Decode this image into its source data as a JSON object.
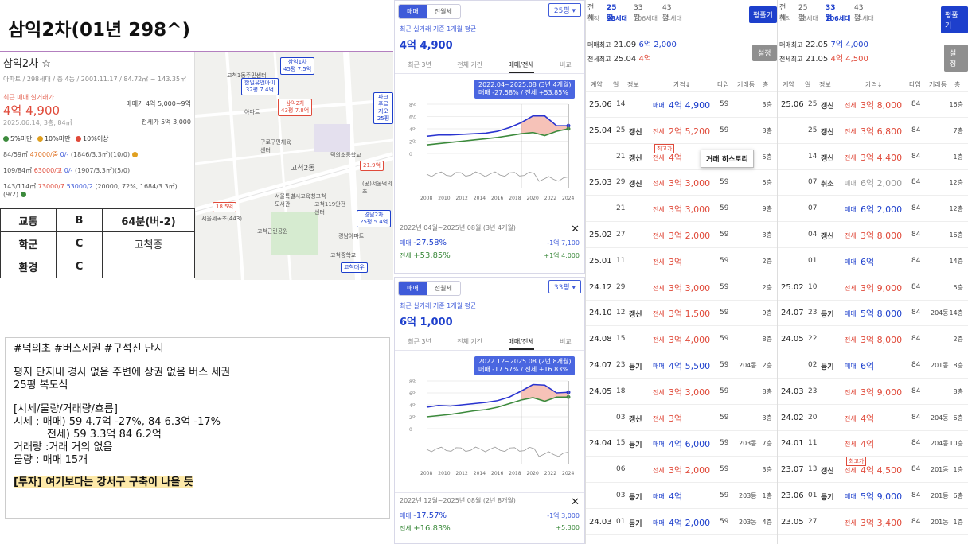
{
  "title": "삼익2차(01년 298^)",
  "card": {
    "name": "삼익2차 ☆",
    "info": "아파트 / 298세대 / 총 4동 / 2001.11.17 / 84.72㎡ ~ 143.35㎡",
    "recent_label": "최근 매매 실거래가",
    "recent_price": "4억 4,900",
    "recent_date": "2025.06.14, 3층, 84㎡",
    "sale_range": "매매가 4억 5,000~9억",
    "rent_range": "전세가 5억 3,000",
    "legend": [
      "5%미만",
      "10%미만",
      "10%이상"
    ],
    "legend_colors": [
      "#3c8a3c",
      "#e0a020",
      "#e04a3a"
    ],
    "rows": [
      {
        "a": "84/59㎡",
        "b": "47000/중",
        "c": "0/-",
        "d": "(1846/3.3㎡)(10/0)"
      },
      {
        "a": "109/84㎡",
        "b": "63000/고",
        "c": "0/-",
        "d": "(1907/3.3㎡)(5/0)"
      },
      {
        "a": "143/114㎡",
        "b": "73000/7",
        "c": "53000/2",
        "d": "(20000, 72%, 1684/3.3㎡)(9/2)"
      }
    ]
  },
  "grades": [
    {
      "k": "교통",
      "g": "B",
      "v": "64분(버-2)"
    },
    {
      "k": "학군",
      "g": "C",
      "v": "고척중"
    },
    {
      "k": "환경",
      "g": "C",
      "v": ""
    }
  ],
  "map": {
    "pins": [
      {
        "t1": "삼익1차",
        "t2": "45평 7.5억",
        "red": false
      },
      {
        "t1": "한일유앤아이",
        "t2": "32평 7.4억",
        "red": false
      },
      {
        "t1": "삼익2차",
        "t2": "43평 7.8억",
        "red": true
      },
      {
        "t1": "파크푸르지오",
        "t2": "25평",
        "red": false
      },
      {
        "t1": "경남2차",
        "t2": "25평 5.4억",
        "red": false
      },
      {
        "t1": "고척대우",
        "t2": "",
        "red": false
      },
      {
        "t1": "21.9억",
        "t2": "",
        "red": true
      },
      {
        "t1": "18.5억",
        "t2": "",
        "red": true
      }
    ],
    "labels": [
      "고척1동주민센터",
      "아파트",
      "구로구민체육센터",
      "고척2동",
      "덕의초등학교",
      "서울특별시교육청고척도서관",
      "고척근린공원",
      "고척119안전센터",
      "서울세곡초(443)",
      "(공)서울덕의초",
      "경남아파트",
      "고척중학교"
    ]
  },
  "memo": {
    "tags": "#덕의초 #버스세권 #구석진 단지",
    "line1": "평지 단지내 경사 없음 주변에 상권 없음 버스 세권",
    "line2": "25평 복도식",
    "line3": "[시세/물량/거래량/흐름]",
    "line4": "시세 : 매매) 59 4.7억 -27%, 84 6.3억 -17%",
    "line5": "전세) 59 3.3억 84 6.2억",
    "line6": "거래량 :거래 거의 없음",
    "line7": "물량 : 매매 15개",
    "line8": "[투자] 여기보다는 강서구 구축이 나을 듯"
  },
  "charts": [
    {
      "seg": [
        "매매",
        "전월세"
      ],
      "size": "25평 ▾",
      "avg_label": "최근 실거래 기준 1개월 평균",
      "avg_price": "4억 4,900",
      "tabs": [
        "최근 3년",
        "전체 기간",
        "매매/전세",
        "비교"
      ],
      "tip1": "2022.04~2025.08 (3년 4개월)",
      "tip2": "매매 -27.58%  /  전세 +53.85%",
      "period": "2022년 04월~2025년 08월 (3년 4개월)",
      "sale_l": "매매",
      "sale_pct": "-27.58%",
      "sale_amt": "-1억 7,100",
      "rent_l": "전세",
      "rent_pct": "+53.85%",
      "rent_amt": "+1억 4,000",
      "close": "✕"
    },
    {
      "seg": [
        "매매",
        "전월세"
      ],
      "size": "33평 ▾",
      "avg_label": "최근 실거래 기준 1개월 평균",
      "avg_price": "6억 1,000",
      "tabs": [
        "최근 3년",
        "전체 기간",
        "매매/전세",
        "비교"
      ],
      "tip1": "2022.12~2025.08 (2년 8개월)",
      "tip2": "매매 -17.57%  /  전세 +16.83%",
      "period": "2022년 12월~2025년 08월 (2년 8개월)",
      "sale_l": "매매",
      "sale_pct": "-17.57%",
      "sale_amt": "-1억 3,000",
      "rent_l": "전세",
      "rent_pct": "+16.83%",
      "rent_amt": "+5,300",
      "close": "✕"
    }
  ],
  "chart_data": [
    {
      "type": "line",
      "xlabels": [
        "2008",
        "2010",
        "2012",
        "2014",
        "2016",
        "2018",
        "2020",
        "2022",
        "2024"
      ],
      "ylabels": [
        "8억",
        "6억",
        "4억",
        "2억",
        "0"
      ],
      "series": [
        {
          "name": "매매",
          "values": [
            2.8,
            3.0,
            3.0,
            3.1,
            3.2,
            3.3,
            3.6,
            4.2,
            5.0,
            6.1,
            6.1,
            4.5,
            4.5
          ]
        },
        {
          "name": "전세",
          "values": [
            1.4,
            1.6,
            1.8,
            2.0,
            2.2,
            2.4,
            2.6,
            2.9,
            3.2,
            3.4,
            2.9,
            3.6,
            4.0
          ]
        }
      ]
    },
    {
      "type": "line",
      "xlabels": [
        "2008",
        "2010",
        "2012",
        "2014",
        "2016",
        "2018",
        "2020",
        "2022",
        "2024"
      ],
      "ylabels": [
        "8억",
        "6억",
        "4억",
        "2억",
        "0"
      ],
      "series": [
        {
          "name": "매매",
          "values": [
            3.6,
            3.9,
            3.8,
            4.0,
            4.2,
            4.4,
            4.7,
            5.3,
            6.3,
            7.4,
            7.3,
            6.0,
            6.1
          ]
        },
        {
          "name": "전세",
          "values": [
            2.0,
            2.2,
            2.4,
            2.7,
            3.0,
            3.2,
            3.6,
            4.2,
            4.8,
            5.2,
            4.6,
            5.3,
            5.3
          ]
        }
      ]
    }
  ],
  "table1": {
    "hdr1": [
      "전체",
      "25평",
      "33평",
      "43평"
    ],
    "hdr2": [
      "면적",
      "98세대",
      "106세대",
      "94세대"
    ],
    "pbtn": "평풀기",
    "sbtn": "설정",
    "hi1_l": "매매최고",
    "hi1_d": "21.09",
    "hi1_p": "6억 2,000",
    "hi2_l": "전세최고",
    "hi2_d": "25.04",
    "hi2_p": "4억",
    "cols": [
      "계약",
      "일",
      "정보",
      "가격↓",
      "타입",
      "거래동",
      "층"
    ],
    "hist": "거래 히스토리",
    "rows": [
      {
        "ym": "25.06",
        "d": "14",
        "i": "",
        "k": "매매",
        "p": "4억 4,900",
        "t": "59",
        "dong": "",
        "f": "3층"
      },
      {
        "ym": "25.04",
        "d": "25",
        "i": "갱신",
        "k": "전세",
        "p": "2억 5,200",
        "t": "59",
        "dong": "",
        "f": "3층"
      },
      {
        "ym": "",
        "d": "21",
        "i": "갱신",
        "k": "전세",
        "p": "4억",
        "t": "59",
        "dong": "",
        "f": "5층",
        "max": "최고가"
      },
      {
        "ym": "25.03",
        "d": "29",
        "i": "갱신",
        "k": "전세",
        "p": "3억 3,000",
        "t": "59",
        "dong": "",
        "f": "5층"
      },
      {
        "ym": "",
        "d": "21",
        "i": "",
        "k": "전세",
        "p": "3억 3,000",
        "t": "59",
        "dong": "",
        "f": "9층"
      },
      {
        "ym": "25.02",
        "d": "27",
        "i": "",
        "k": "전세",
        "p": "3억 2,000",
        "t": "59",
        "dong": "",
        "f": "3층"
      },
      {
        "ym": "25.01",
        "d": "11",
        "i": "",
        "k": "전세",
        "p": "3억",
        "t": "59",
        "dong": "",
        "f": "2층"
      },
      {
        "ym": "24.12",
        "d": "29",
        "i": "",
        "k": "전세",
        "p": "3억 3,000",
        "t": "59",
        "dong": "",
        "f": "2층"
      },
      {
        "ym": "24.10",
        "d": "12",
        "i": "갱신",
        "k": "전세",
        "p": "3억 1,500",
        "t": "59",
        "dong": "",
        "f": "9층"
      },
      {
        "ym": "24.08",
        "d": "15",
        "i": "",
        "k": "전세",
        "p": "3억 4,000",
        "t": "59",
        "dong": "",
        "f": "8층"
      },
      {
        "ym": "24.07",
        "d": "23",
        "i": "등기",
        "k": "매매",
        "p": "4억 5,500",
        "t": "59",
        "dong": "204동",
        "f": "2층"
      },
      {
        "ym": "24.05",
        "d": "18",
        "i": "",
        "k": "전세",
        "p": "3억 3,000",
        "t": "59",
        "dong": "",
        "f": "8층"
      },
      {
        "ym": "",
        "d": "03",
        "i": "갱신",
        "k": "전세",
        "p": "3억",
        "t": "59",
        "dong": "",
        "f": "3층"
      },
      {
        "ym": "24.04",
        "d": "15",
        "i": "등기",
        "k": "매매",
        "p": "4억 6,000",
        "t": "59",
        "dong": "203동",
        "f": "7층"
      },
      {
        "ym": "",
        "d": "06",
        "i": "",
        "k": "전세",
        "p": "3억 2,000",
        "t": "59",
        "dong": "",
        "f": "3층"
      },
      {
        "ym": "",
        "d": "03",
        "i": "등기",
        "k": "매매",
        "p": "4억",
        "t": "59",
        "dong": "203동",
        "f": "1층"
      },
      {
        "ym": "24.03",
        "d": "01",
        "i": "등기",
        "k": "매매",
        "p": "4억 2,000",
        "t": "59",
        "dong": "203동",
        "f": "4층"
      }
    ]
  },
  "table2": {
    "hdr1": [
      "전체",
      "25평",
      "33평",
      "43평"
    ],
    "hdr2": [
      "면적",
      "98세대",
      "106세대",
      "94세대"
    ],
    "pbtn": "평풀기",
    "sbtn": "설정",
    "hi1_l": "매매최고",
    "hi1_d": "22.05",
    "hi1_p": "7억 4,000",
    "hi2_l": "전세최고",
    "hi2_d": "21.05",
    "hi2_p": "4억 4,500",
    "cols": [
      "계약",
      "일",
      "정보",
      "가격↓",
      "타입",
      "거래동",
      "층"
    ],
    "rows": [
      {
        "ym": "25.06",
        "d": "25",
        "i": "갱신",
        "k": "전세",
        "p": "3억 8,000",
        "t": "84",
        "dong": "",
        "f": "16층"
      },
      {
        "ym": "",
        "d": "25",
        "i": "갱신",
        "k": "전세",
        "p": "3억 6,800",
        "t": "84",
        "dong": "",
        "f": "7층"
      },
      {
        "ym": "",
        "d": "14",
        "i": "갱신",
        "k": "전세",
        "p": "3억 4,400",
        "t": "84",
        "dong": "",
        "f": "1층"
      },
      {
        "ym": "",
        "d": "07",
        "i": "취소",
        "k": "매매",
        "p": "6억 2,000",
        "t": "84",
        "dong": "",
        "f": "12층"
      },
      {
        "ym": "",
        "d": "07",
        "i": "",
        "k": "매매",
        "p": "6억 2,000",
        "t": "84",
        "dong": "",
        "f": "12층"
      },
      {
        "ym": "",
        "d": "04",
        "i": "갱신",
        "k": "전세",
        "p": "3억 8,000",
        "t": "84",
        "dong": "",
        "f": "16층"
      },
      {
        "ym": "",
        "d": "01",
        "i": "",
        "k": "매매",
        "p": "6억",
        "t": "84",
        "dong": "",
        "f": "14층"
      },
      {
        "ym": "25.02",
        "d": "10",
        "i": "",
        "k": "전세",
        "p": "3억 9,000",
        "t": "84",
        "dong": "",
        "f": "5층"
      },
      {
        "ym": "24.07",
        "d": "23",
        "i": "등기",
        "k": "매매",
        "p": "5억 8,000",
        "t": "84",
        "dong": "204동",
        "f": "14층"
      },
      {
        "ym": "24.05",
        "d": "22",
        "i": "",
        "k": "전세",
        "p": "3억 8,000",
        "t": "84",
        "dong": "",
        "f": "2층"
      },
      {
        "ym": "",
        "d": "02",
        "i": "등기",
        "k": "매매",
        "p": "6억",
        "t": "84",
        "dong": "201동",
        "f": "8층"
      },
      {
        "ym": "24.03",
        "d": "23",
        "i": "",
        "k": "전세",
        "p": "3억 9,000",
        "t": "84",
        "dong": "",
        "f": "8층"
      },
      {
        "ym": "24.02",
        "d": "20",
        "i": "",
        "k": "전세",
        "p": "4억",
        "t": "84",
        "dong": "204동",
        "f": "6층"
      },
      {
        "ym": "24.01",
        "d": "11",
        "i": "",
        "k": "전세",
        "p": "4억",
        "t": "84",
        "dong": "204동",
        "f": "10층"
      },
      {
        "ym": "23.07",
        "d": "13",
        "i": "갱신",
        "k": "전세",
        "p": "4억 4,500",
        "t": "84",
        "dong": "201동",
        "f": "1층",
        "max": "최고가"
      },
      {
        "ym": "23.06",
        "d": "01",
        "i": "등기",
        "k": "매매",
        "p": "5억 9,000",
        "t": "84",
        "dong": "201동",
        "f": "6층"
      },
      {
        "ym": "23.05",
        "d": "27",
        "i": "",
        "k": "전세",
        "p": "3억 3,400",
        "t": "84",
        "dong": "201동",
        "f": "1층"
      }
    ]
  }
}
